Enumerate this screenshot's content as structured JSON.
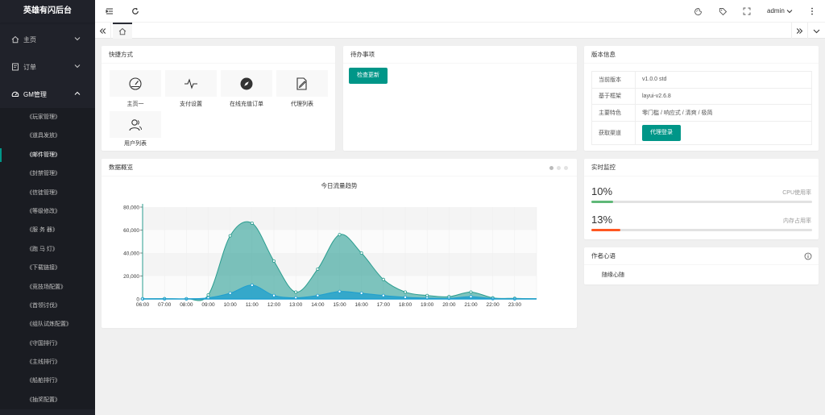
{
  "sidebar": {
    "title": "英雄有闪后台",
    "items": [
      {
        "label": "主页",
        "icon": "home-icon"
      },
      {
        "label": "订单",
        "icon": "order-icon"
      },
      {
        "label": "GM管理",
        "icon": "dashboard-icon"
      }
    ],
    "sub_items": [
      "《玩家管理》",
      "《道具发放》",
      "《邮件管理》",
      "《封禁管理》",
      "《信徒管理》",
      "《等级修改》",
      "《服 务 器》",
      "《跑 马 灯》",
      "《下载链接》",
      "《竞技场配置》",
      "《首领讨伐》",
      "《组队试炼配置》",
      "《守国排行》",
      "《主线排行》",
      "《船舶排行》",
      "《抽奖配置》"
    ],
    "active_sub": "《邮件管理》"
  },
  "header": {
    "user": "admin",
    "icons": [
      "menu-fold-icon",
      "refresh-icon",
      "theme-icon",
      "tag-icon",
      "fullscreen-icon",
      "more-icon"
    ]
  },
  "tabs": {
    "home_icon": "home-icon"
  },
  "shortcuts": {
    "title": "快捷方式",
    "items": [
      {
        "label": "主页一",
        "icon": "gauge-icon"
      },
      {
        "label": "支付设置",
        "icon": "pulse-icon"
      },
      {
        "label": "在线充值订单",
        "icon": "compass-icon"
      },
      {
        "label": "代理列表",
        "icon": "edit-doc-icon"
      },
      {
        "label": "用户列表",
        "icon": "users-icon"
      }
    ]
  },
  "todo": {
    "title": "待办事项",
    "button": "检查更新"
  },
  "version": {
    "title": "版本信息",
    "rows": [
      {
        "key": "当前版本",
        "value": "v1.0.0 std"
      },
      {
        "key": "基于框架",
        "value": "layui-v2.6.8"
      },
      {
        "key": "主要特色",
        "value": "零门槛 / 响应式 / 清爽 / 极简"
      },
      {
        "key": "获取渠道",
        "value": "代理登录"
      }
    ]
  },
  "overview": {
    "title": "数据概览"
  },
  "monitor": {
    "title": "实时监控",
    "cpu": {
      "value": "10%",
      "label": "CPU使用率",
      "fraction": 0.1,
      "color": "#5fb878"
    },
    "mem": {
      "value": "13%",
      "label": "内存占用率",
      "fraction": 0.13,
      "color": "#ff5722"
    }
  },
  "notes": {
    "title": "作者心语",
    "text": "随缘心随"
  },
  "chart_data": {
    "type": "area",
    "title": "今日流量趋势",
    "categories": [
      "06:00",
      "07:00",
      "08:00",
      "09:00",
      "10:00",
      "11:00",
      "12:00",
      "13:00",
      "14:00",
      "15:00",
      "16:00",
      "17:00",
      "18:00",
      "19:00",
      "20:00",
      "21:00",
      "22:00",
      "23:00"
    ],
    "yticks": [
      "0",
      "20,000",
      "40,000",
      "60,000",
      "80,000"
    ],
    "ylim": [
      0,
      80000
    ],
    "grid": true,
    "series": [
      {
        "color": "#2ec7c9",
        "values": [
          200,
          300,
          200,
          3500,
          55000,
          66000,
          33000,
          6000,
          26000,
          56000,
          40000,
          17000,
          6000,
          3000,
          2000,
          6000,
          1000,
          500
        ]
      },
      {
        "color": "#1e9fcf",
        "values": [
          100,
          100,
          100,
          1000,
          5000,
          12000,
          3000,
          1000,
          3000,
          6500,
          5000,
          3000,
          1500,
          800,
          500,
          2000,
          300,
          100
        ]
      }
    ]
  }
}
